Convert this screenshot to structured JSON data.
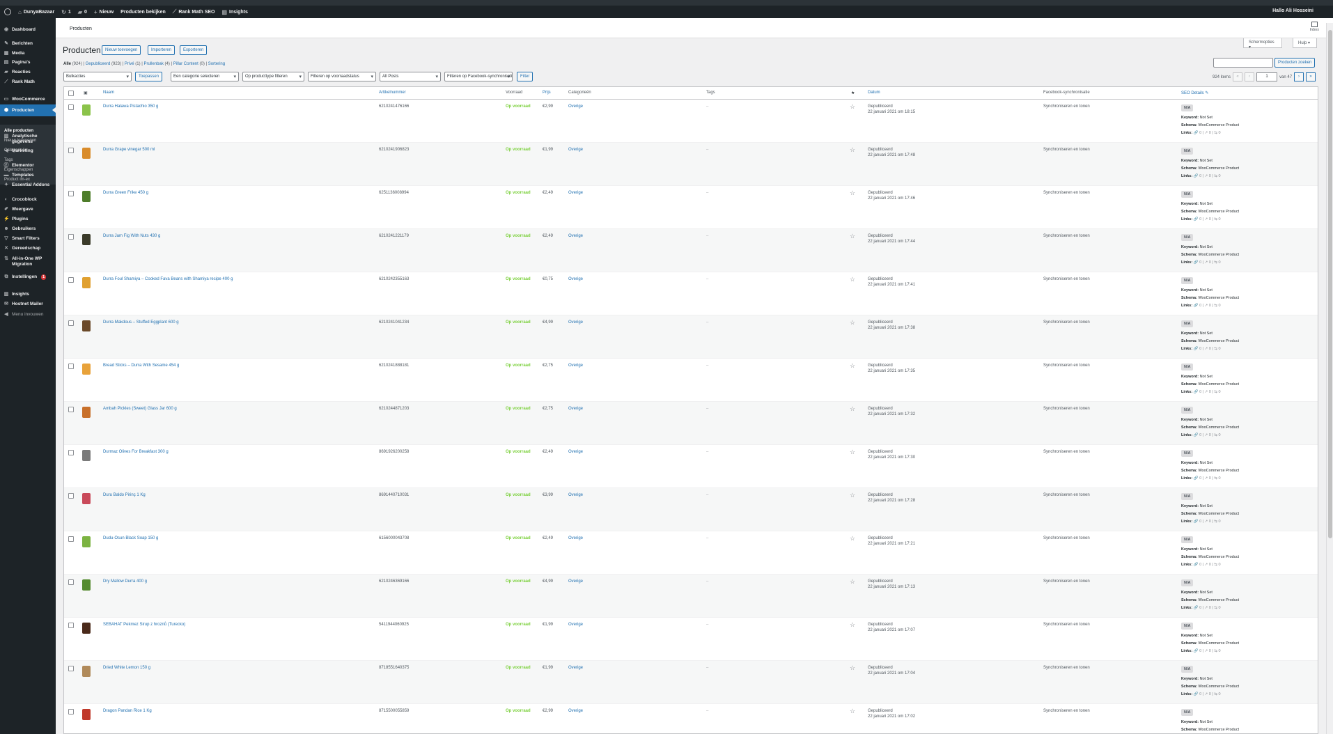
{
  "adminbar": {
    "site_name": "DunyaBazaar",
    "updates_count": "1",
    "comments_count": "0",
    "new_label": "Nieuw",
    "view_products": "Producten bekijken",
    "rank_math": "Rank Math SEO",
    "insights": "Insights",
    "greeting": "Hallo Ali Hosseini"
  },
  "sidebar": {
    "items": [
      {
        "label": "Dashboard",
        "icon": "dashboard-icon"
      },
      {
        "label": "Berichten",
        "icon": "pin-icon"
      },
      {
        "label": "Media",
        "icon": "media-icon"
      },
      {
        "label": "Pagina's",
        "icon": "page-icon"
      },
      {
        "label": "Reacties",
        "icon": "comment-icon"
      },
      {
        "label": "Rank Math",
        "icon": "rank-math-icon"
      },
      {
        "label": "WooCommerce",
        "icon": "woocommerce-icon"
      },
      {
        "label": "Producten",
        "icon": "product-box-icon"
      },
      {
        "label": "Analytische gegevens",
        "icon": "bar-chart-icon"
      },
      {
        "label": "Marketing",
        "icon": "megaphone-icon"
      },
      {
        "label": "Elementor",
        "icon": "elementor-icon"
      },
      {
        "label": "Templates",
        "icon": "folder-icon"
      },
      {
        "label": "Essential Addons",
        "icon": "addons-icon"
      },
      {
        "label": "Crocoblock",
        "icon": "crocoblock-icon"
      },
      {
        "label": "Weergave",
        "icon": "brush-icon"
      },
      {
        "label": "Plugins",
        "icon": "plugin-icon"
      },
      {
        "label": "Gebruikers",
        "icon": "users-icon"
      },
      {
        "label": "Smart Filters",
        "icon": "filter-icon"
      },
      {
        "label": "Gereedschap",
        "icon": "wrench-icon"
      },
      {
        "label": "All-in-One WP Migration",
        "icon": "migration-icon"
      },
      {
        "label": "Instellingen",
        "icon": "settings-icon",
        "badge": "1"
      },
      {
        "label": "Insights",
        "icon": "insights-icon"
      },
      {
        "label": "Hostnet Mailer",
        "icon": "mail-icon"
      },
      {
        "label": "Menu invouwen",
        "icon": "collapse-icon"
      }
    ],
    "submenu": [
      "Alle producten",
      "Nieuw toevoegen",
      "Categorieën",
      "Tags",
      "Eigenschappen",
      "Product im-ex"
    ]
  },
  "topbar": {
    "breadcrumb": "Producten",
    "inbox": "Inbox"
  },
  "screen_options": "Schermopties",
  "help": "Hulp",
  "page": {
    "title": "Producten",
    "buttons": {
      "add_new": "Nieuw toevoegen",
      "import": "Importeren",
      "export": "Exporteren"
    },
    "views": {
      "all": "Alle",
      "all_count": "(924)",
      "published": "Gepubliceerd",
      "published_count": "(923)",
      "private": "Privé",
      "private_count": "(1)",
      "drafts": "Prullenbak",
      "drafts_count": "(4)",
      "pillar": "Pillar Content",
      "pillar_count": "(0)",
      "sorting": "Sortering"
    },
    "filters": {
      "bulk": "Bulkacties",
      "apply": "Toepassen",
      "category": "Een categorie selecteren",
      "product_type": "Op producttype filteren",
      "stock_status": "Filteren op voorraadstatus",
      "posts": "All Posts",
      "facebook": "Filteren op Facebook-synchronisatie",
      "filter_btn": "Filter"
    },
    "search_btn": "Producten zoeken",
    "items_count": "924 items",
    "current_page": "1",
    "total_pages": "van 47"
  },
  "table": {
    "headers": {
      "name": "Naam",
      "sku": "Artikelnummer",
      "stock": "Voorraad",
      "price": "Prijs",
      "categories": "Categorieën",
      "tags": "Tags",
      "featured": "★",
      "date": "Datum",
      "facebook": "Facebook-synchronisatie",
      "seo": "SEO Details"
    },
    "rows": [
      {
        "name": "Durra Halawa Pistachio 350 g",
        "sku": "6210241476166",
        "stock": "Op voorraad",
        "price": "€2,99",
        "category": "Overige",
        "tags": "–",
        "status": "Gepubliceerd",
        "date": "22 januari 2021 om 18:15",
        "facebook": "Synchroniseren en tonen",
        "thumb": "#8bc34a"
      },
      {
        "name": "Durra Grape vinegar 500 ml",
        "sku": "6210241906823",
        "stock": "Op voorraad",
        "price": "€1,99",
        "category": "Overige",
        "tags": "–",
        "status": "Gepubliceerd",
        "date": "22 januari 2021 om 17:48",
        "facebook": "Synchroniseren en tonen",
        "thumb": "#d98c2b"
      },
      {
        "name": "Durra Green Frike 450 g",
        "sku": "6251136008994",
        "stock": "Op voorraad",
        "price": "€2,49",
        "category": "Overige",
        "tags": "–",
        "status": "Gepubliceerd",
        "date": "22 januari 2021 om 17:46",
        "facebook": "Synchroniseren en tonen",
        "thumb": "#4e7d2a"
      },
      {
        "name": "Durra Jam Fig With Nuts 430 g",
        "sku": "6210241221179",
        "stock": "Op voorraad",
        "price": "€2,49",
        "category": "Overige",
        "tags": "–",
        "status": "Gepubliceerd",
        "date": "22 januari 2021 om 17:44",
        "facebook": "Synchroniseren en tonen",
        "thumb": "#3b3b2a"
      },
      {
        "name": "Durra Foul Shamiya – Cooked Fava Beans with Shamiya recipe 400 g",
        "sku": "6210242355163",
        "stock": "Op voorraad",
        "price": "€0,75",
        "category": "Overige",
        "tags": "–",
        "status": "Gepubliceerd",
        "date": "22 januari 2021 om 17:41",
        "facebook": "Synchroniseren en tonen",
        "thumb": "#e0a030"
      },
      {
        "name": "Durra Makdous – Stuffed Eggplant 600 g",
        "sku": "6210241041234",
        "stock": "Op voorraad",
        "price": "€4,99",
        "category": "Overige",
        "tags": "–",
        "status": "Gepubliceerd",
        "date": "22 januari 2021 om 17:38",
        "facebook": "Synchroniseren en tonen",
        "thumb": "#6b4a2a"
      },
      {
        "name": "Bread Sticks – Durra With Sesame 454 g",
        "sku": "6210241888181",
        "stock": "Op voorraad",
        "price": "€2,75",
        "category": "Overige",
        "tags": "–",
        "status": "Gepubliceerd",
        "date": "22 januari 2021 om 17:35",
        "facebook": "Synchroniseren en tonen",
        "thumb": "#e8a23a"
      },
      {
        "name": "Ambah Pickles (Sweet) Glass Jar 600 g",
        "sku": "6210244871203",
        "stock": "Op voorraad",
        "price": "€2,75",
        "category": "Overige",
        "tags": "–",
        "status": "Gepubliceerd",
        "date": "22 januari 2021 om 17:32",
        "facebook": "Synchroniseren en tonen",
        "thumb": "#c8702a"
      },
      {
        "name": "Durmaz Olives For Breakfast 300 g",
        "sku": "8691926200258",
        "stock": "Op voorraad",
        "price": "€2,49",
        "category": "Overige",
        "tags": "–",
        "status": "Gepubliceerd",
        "date": "22 januari 2021 om 17:30",
        "facebook": "Synchroniseren en tonen",
        "thumb": "#7a7a7a"
      },
      {
        "name": "Duru Baldo Pirinç 1 Kg",
        "sku": "8691440710031",
        "stock": "Op voorraad",
        "price": "€3,99",
        "category": "Overige",
        "tags": "–",
        "status": "Gepubliceerd",
        "date": "22 januari 2021 om 17:28",
        "facebook": "Synchroniseren en tonen",
        "thumb": "#c94a5a"
      },
      {
        "name": "Dudu-Osun Black Soap 150 g",
        "sku": "6156000043708",
        "stock": "Op voorraad",
        "price": "€2,49",
        "category": "Overige",
        "tags": "–",
        "status": "Gepubliceerd",
        "date": "22 januari 2021 om 17:21",
        "facebook": "Synchroniseren en tonen",
        "thumb": "#7cb342"
      },
      {
        "name": "Dry Mallow Durra 400 g",
        "sku": "6210246369166",
        "stock": "Op voorraad",
        "price": "€4,99",
        "category": "Overige",
        "tags": "–",
        "status": "Gepubliceerd",
        "date": "22 januari 2021 om 17:13",
        "facebook": "Synchroniseren en tonen",
        "thumb": "#558b2f"
      },
      {
        "name": "SEBAHAT Pekmez Sirup z hroznů (Turecko)",
        "sku": "5411944060925",
        "stock": "Op voorraad",
        "price": "€1,99",
        "category": "Overige",
        "tags": "–",
        "status": "Gepubliceerd",
        "date": "22 januari 2021 om 17:07",
        "facebook": "Synchroniseren en tonen",
        "thumb": "#4a2a1a"
      },
      {
        "name": "Dried White Lemon 150 g",
        "sku": "8718551640375",
        "stock": "Op voorraad",
        "price": "€1,99",
        "category": "Overige",
        "tags": "–",
        "status": "Gepubliceerd",
        "date": "22 januari 2021 om 17:04",
        "facebook": "Synchroniseren en tonen",
        "thumb": "#b08a5a"
      },
      {
        "name": "Dragon Pandan Rice 1 Kg",
        "sku": "8715500055859",
        "stock": "Op voorraad",
        "price": "€2,99",
        "category": "Overige",
        "tags": "–",
        "status": "Gepubliceerd",
        "date": "22 januari 2021 om 17:02",
        "facebook": "Synchroniseren en tonen",
        "thumb": "#c0392b"
      }
    ],
    "seo": {
      "badge": "N/A",
      "keyword_label": "Keyword:",
      "keyword_value": "Not Set",
      "schema_label": "Schema:",
      "schema_value": "WooCommerce Product",
      "links_label": "Links:",
      "links_value": "🔗 0 | ↗ 0 | ⇆ 0"
    }
  },
  "colors": {
    "accent": "#2271b1",
    "sidebar": "#1d2327",
    "stock": "#7ad03a"
  }
}
